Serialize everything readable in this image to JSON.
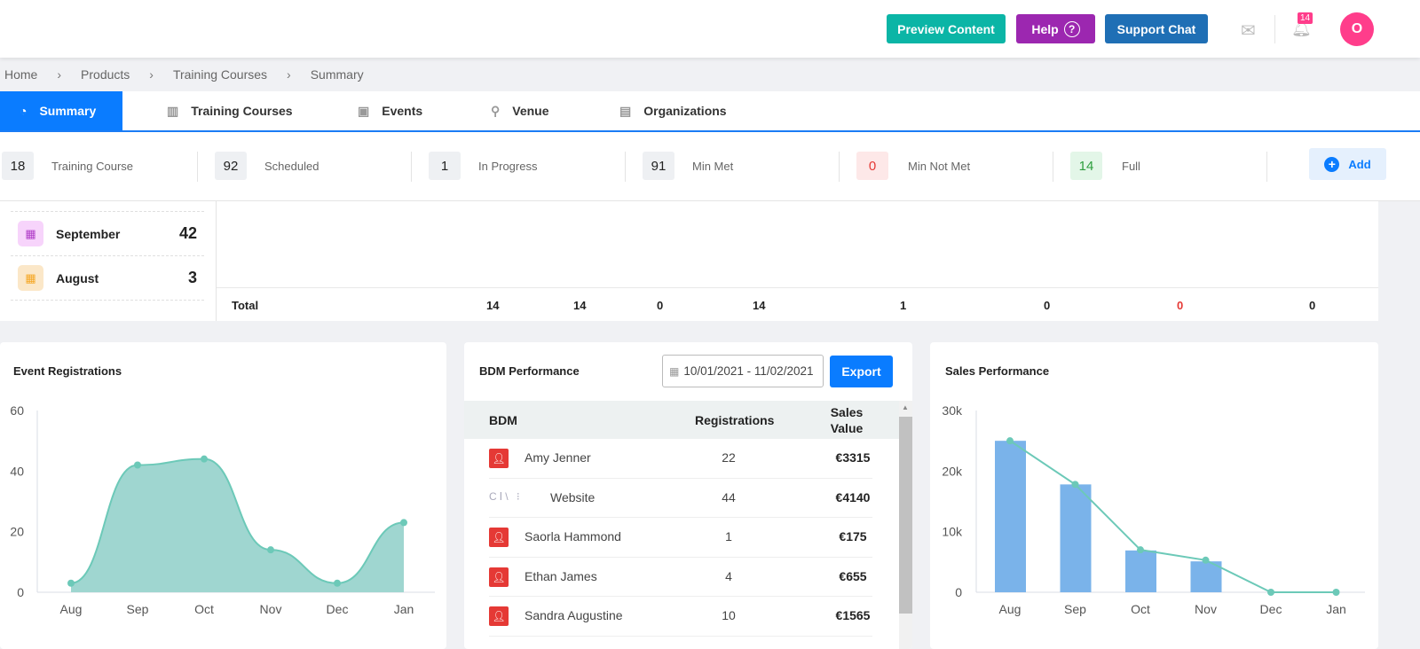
{
  "header": {
    "preview": "Preview Content",
    "help": "Help",
    "support": "Support Chat",
    "notif_count": "14",
    "avatar": "O",
    "colors": {
      "preview": "#0bb5a6",
      "help": "#9c27b0",
      "support": "#1f6fb5",
      "avatar": "#ff3d8b"
    }
  },
  "breadcrumb": [
    "Home",
    "Products",
    "Training Courses",
    "Summary"
  ],
  "tabs": [
    {
      "label": "Summary",
      "icon": "gauge-icon"
    },
    {
      "label": "Training Courses",
      "icon": "book-icon"
    },
    {
      "label": "Events",
      "icon": "presentation-icon"
    },
    {
      "label": "Venue",
      "icon": "map-pin-icon"
    },
    {
      "label": "Organizations",
      "icon": "briefcase-icon"
    }
  ],
  "stats": [
    {
      "value": "18",
      "label": "Training Course"
    },
    {
      "value": "92",
      "label": "Scheduled"
    },
    {
      "value": "1",
      "label": "In Progress"
    },
    {
      "value": "91",
      "label": "Min Met"
    },
    {
      "value": "0",
      "label": "Min Not Met"
    },
    {
      "value": "14",
      "label": "Full"
    }
  ],
  "add_label": "Add",
  "months": [
    {
      "name": "September",
      "value": "42"
    },
    {
      "name": "August",
      "value": "3"
    }
  ],
  "totals": {
    "label": "Total",
    "values": [
      "14",
      "14",
      "0",
      "14",
      "1",
      "0",
      "0",
      "0"
    ]
  },
  "bdm": {
    "title": "BDM Performance",
    "date_range": "10/01/2021 - 11/02/2021",
    "export": "Export",
    "columns": [
      "BDM",
      "Registrations",
      "Sales Value"
    ],
    "rows": [
      {
        "name": "Amy Jenner",
        "reg": "22",
        "sales": "€3315"
      },
      {
        "name": "Website",
        "reg": "44",
        "sales": "€4140"
      },
      {
        "name": "Saorla Hammond",
        "reg": "1",
        "sales": "€175"
      },
      {
        "name": "Ethan James",
        "reg": "4",
        "sales": "€655"
      },
      {
        "name": "Sandra Augustine",
        "reg": "10",
        "sales": "€1565"
      }
    ]
  },
  "chart_data": [
    {
      "type": "area",
      "title": "Event Registrations",
      "categories": [
        "Aug",
        "Sep",
        "Oct",
        "Nov",
        "Dec",
        "Jan"
      ],
      "values": [
        3,
        42,
        44,
        14,
        3,
        23
      ],
      "ylim": [
        0,
        60
      ],
      "yticks": [
        "0",
        "20",
        "40",
        "60"
      ],
      "color": "#8fd3cb"
    },
    {
      "type": "bar",
      "title": "Sales Performance",
      "categories": [
        "Aug",
        "Sep",
        "Oct",
        "Nov",
        "Dec",
        "Jan"
      ],
      "series": [
        {
          "type": "bar",
          "values": [
            25000,
            17800,
            6900,
            5100,
            0,
            0
          ],
          "color": "#7ab3ea"
        },
        {
          "type": "line",
          "values": [
            25000,
            17800,
            7000,
            5300,
            0,
            0
          ],
          "color": "#6cc9b8"
        }
      ],
      "ylim": [
        0,
        30000
      ],
      "yticks": [
        "0",
        "10k",
        "20k",
        "30k"
      ]
    }
  ]
}
